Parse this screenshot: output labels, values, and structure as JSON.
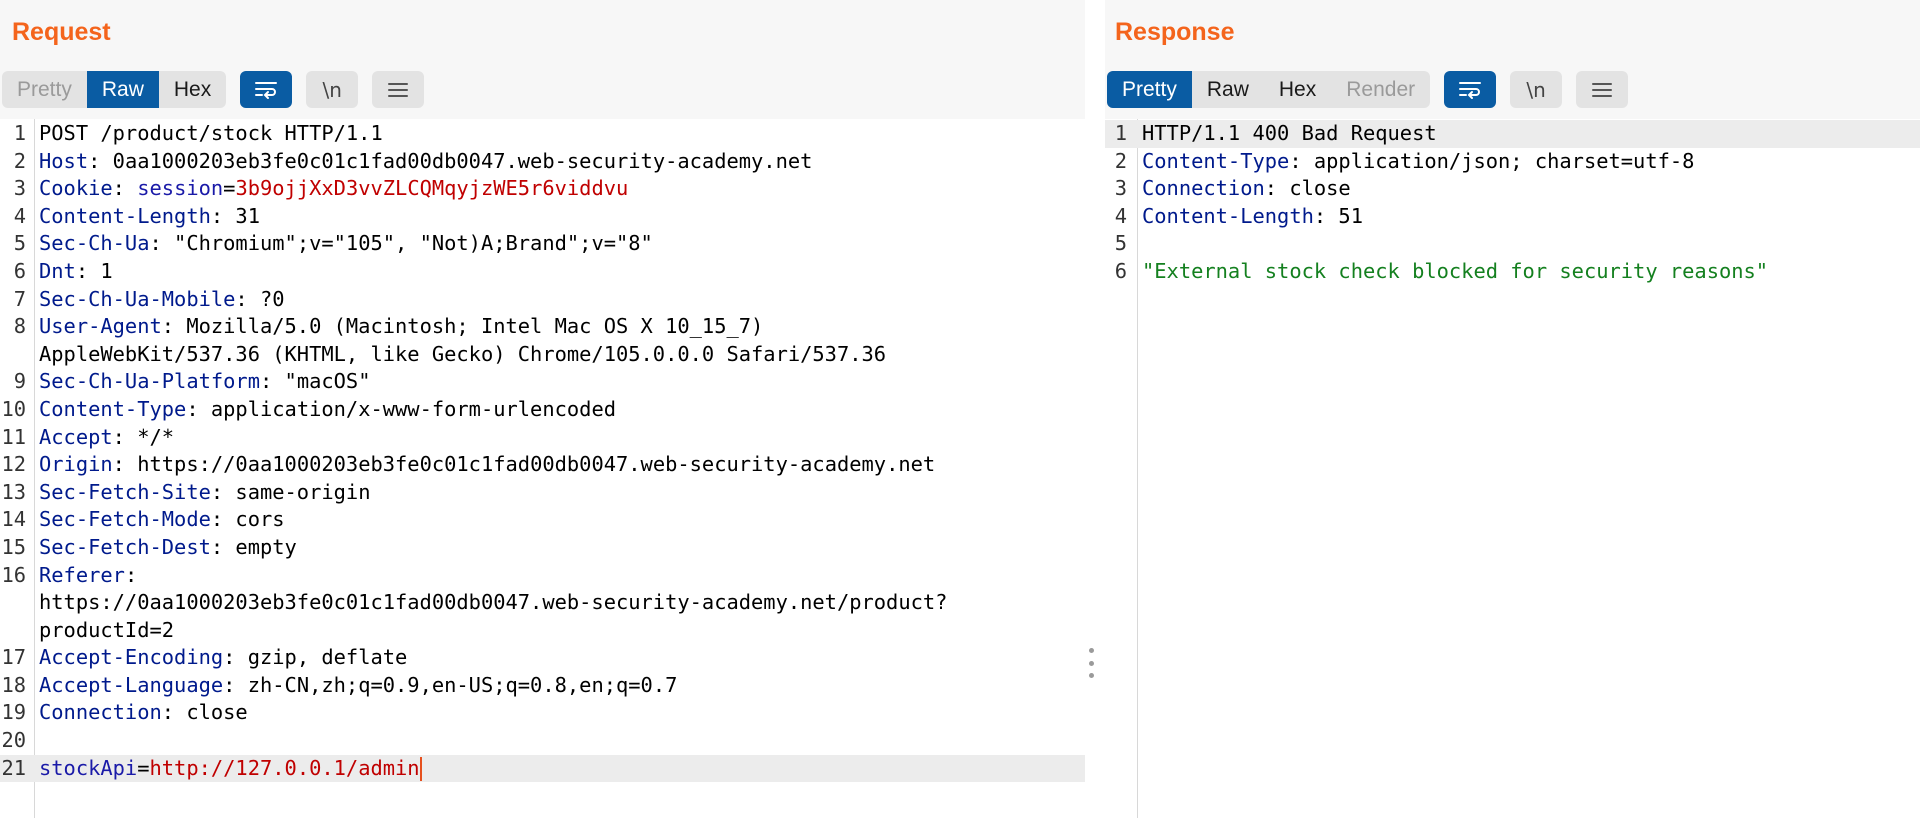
{
  "request": {
    "title": "Request",
    "view_tabs": [
      {
        "label": "Pretty",
        "state": "muted"
      },
      {
        "label": "Raw",
        "state": "active"
      },
      {
        "label": "Hex",
        "state": "normal"
      }
    ],
    "tools": {
      "wrap_icon": "wrap-lines-icon",
      "newline_label": "\\n",
      "menu_icon": "hamburger-menu-icon"
    },
    "lines": [
      {
        "n": "1",
        "parts": [
          {
            "t": "POST /product/stock HTTP/1.1",
            "c": "p"
          }
        ]
      },
      {
        "n": "2",
        "parts": [
          {
            "t": "Host",
            "c": "k"
          },
          {
            "t": ": 0aa1000203eb3fe0c01c1fad00db0047.web-security-academy.net",
            "c": "p"
          }
        ]
      },
      {
        "n": "3",
        "parts": [
          {
            "t": "Cookie",
            "c": "k"
          },
          {
            "t": ": ",
            "c": "p"
          },
          {
            "t": "session",
            "c": "blu"
          },
          {
            "t": "=",
            "c": "p"
          },
          {
            "t": "3b9ojjXxD3vvZLCQMqyjzWE5r6viddvu",
            "c": "red"
          }
        ]
      },
      {
        "n": "4",
        "parts": [
          {
            "t": "Content-Length",
            "c": "k"
          },
          {
            "t": ": 31",
            "c": "p"
          }
        ]
      },
      {
        "n": "5",
        "parts": [
          {
            "t": "Sec-Ch-Ua",
            "c": "k"
          },
          {
            "t": ": \"Chromium\";v=\"105\", \"Not)A;Brand\";v=\"8\"",
            "c": "p"
          }
        ]
      },
      {
        "n": "6",
        "parts": [
          {
            "t": "Dnt",
            "c": "k"
          },
          {
            "t": ": 1",
            "c": "p"
          }
        ]
      },
      {
        "n": "7",
        "parts": [
          {
            "t": "Sec-Ch-Ua-Mobile",
            "c": "k"
          },
          {
            "t": ": ?0",
            "c": "p"
          }
        ]
      },
      {
        "n": "8",
        "rows": 2,
        "parts": [
          {
            "t": "User-Agent",
            "c": "k"
          },
          {
            "t": ": Mozilla/5.0 (Macintosh; Intel Mac OS X 10_15_7)\nAppleWebKit/537.36 (KHTML, like Gecko) Chrome/105.0.0.0 Safari/537.36",
            "c": "p"
          }
        ]
      },
      {
        "n": "9",
        "parts": [
          {
            "t": "Sec-Ch-Ua-Platform",
            "c": "k"
          },
          {
            "t": ": \"macOS\"",
            "c": "p"
          }
        ]
      },
      {
        "n": "10",
        "parts": [
          {
            "t": "Content-Type",
            "c": "k"
          },
          {
            "t": ": application/x-www-form-urlencoded",
            "c": "p"
          }
        ]
      },
      {
        "n": "11",
        "parts": [
          {
            "t": "Accept",
            "c": "k"
          },
          {
            "t": ": */*",
            "c": "p"
          }
        ]
      },
      {
        "n": "12",
        "parts": [
          {
            "t": "Origin",
            "c": "k"
          },
          {
            "t": ": https://0aa1000203eb3fe0c01c1fad00db0047.web-security-academy.net",
            "c": "p"
          }
        ]
      },
      {
        "n": "13",
        "parts": [
          {
            "t": "Sec-Fetch-Site",
            "c": "k"
          },
          {
            "t": ": same-origin",
            "c": "p"
          }
        ]
      },
      {
        "n": "14",
        "parts": [
          {
            "t": "Sec-Fetch-Mode",
            "c": "k"
          },
          {
            "t": ": cors",
            "c": "p"
          }
        ]
      },
      {
        "n": "15",
        "parts": [
          {
            "t": "Sec-Fetch-Dest",
            "c": "k"
          },
          {
            "t": ": empty",
            "c": "p"
          }
        ]
      },
      {
        "n": "16",
        "rows": 3,
        "parts": [
          {
            "t": "Referer",
            "c": "k"
          },
          {
            "t": ":\nhttps://0aa1000203eb3fe0c01c1fad00db0047.web-security-academy.net/product?\nproductId=2",
            "c": "p"
          }
        ]
      },
      {
        "n": "17",
        "parts": [
          {
            "t": "Accept-Encoding",
            "c": "k"
          },
          {
            "t": ": gzip, deflate",
            "c": "p"
          }
        ]
      },
      {
        "n": "18",
        "parts": [
          {
            "t": "Accept-Language",
            "c": "k"
          },
          {
            "t": ": zh-CN,zh;q=0.9,en-US;q=0.8,en;q=0.7",
            "c": "p"
          }
        ]
      },
      {
        "n": "19",
        "parts": [
          {
            "t": "Connection",
            "c": "k"
          },
          {
            "t": ": close",
            "c": "p"
          }
        ]
      },
      {
        "n": "20",
        "parts": []
      },
      {
        "n": "21",
        "current": true,
        "caret": true,
        "parts": [
          {
            "t": "stockApi",
            "c": "blu"
          },
          {
            "t": "=",
            "c": "p"
          },
          {
            "t": "http://127.0.0.1/admin",
            "c": "red"
          }
        ]
      }
    ]
  },
  "response": {
    "title": "Response",
    "view_tabs": [
      {
        "label": "Pretty",
        "state": "active"
      },
      {
        "label": "Raw",
        "state": "normal"
      },
      {
        "label": "Hex",
        "state": "normal"
      },
      {
        "label": "Render",
        "state": "muted"
      }
    ],
    "tools": {
      "wrap_icon": "wrap-lines-icon",
      "newline_label": "\\n",
      "menu_icon": "hamburger-menu-icon"
    },
    "lines": [
      {
        "n": "1",
        "current": true,
        "parts": [
          {
            "t": "HTTP/1.1 400 Bad Request",
            "c": "p"
          }
        ]
      },
      {
        "n": "2",
        "parts": [
          {
            "t": "Content-Type",
            "c": "k"
          },
          {
            "t": ": application/json; charset=utf-8",
            "c": "p"
          }
        ]
      },
      {
        "n": "3",
        "parts": [
          {
            "t": "Connection",
            "c": "k"
          },
          {
            "t": ": close",
            "c": "p"
          }
        ]
      },
      {
        "n": "4",
        "parts": [
          {
            "t": "Content-Length",
            "c": "k"
          },
          {
            "t": ": 51",
            "c": "p"
          }
        ]
      },
      {
        "n": "5",
        "parts": []
      },
      {
        "n": "6",
        "parts": [
          {
            "t": "\"External stock check blocked for security reasons\"",
            "c": "grn"
          }
        ]
      }
    ]
  },
  "colors": {
    "accent": "#f4641c",
    "active_tab": "#0a5ca3",
    "header_key": "#001a8c",
    "value_red": "#c00000",
    "string_green": "#14801f"
  }
}
